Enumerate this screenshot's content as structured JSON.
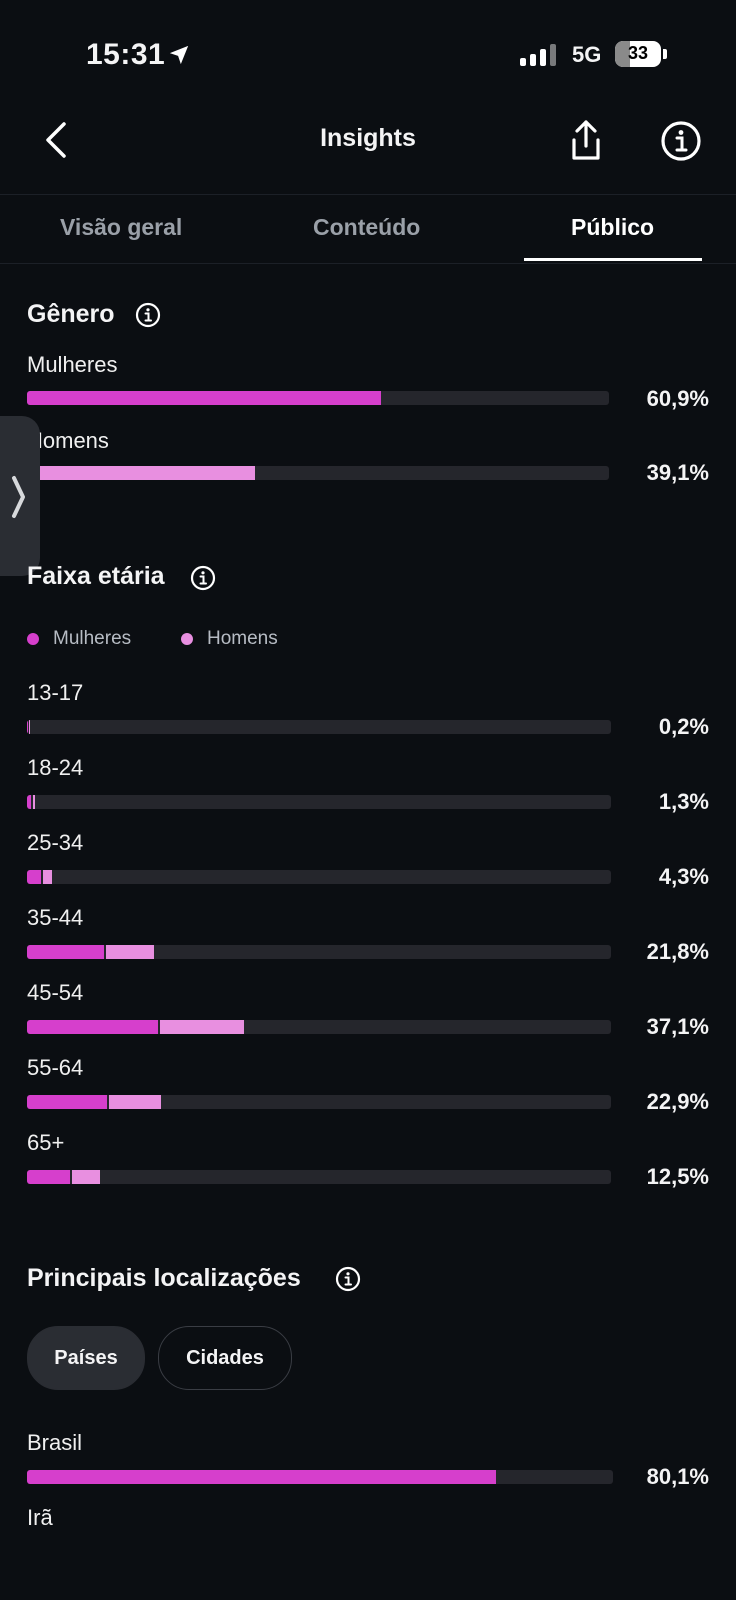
{
  "status": {
    "time": "15:31",
    "network": "5G",
    "battery": "33",
    "battery_level": 0.33
  },
  "header": {
    "title": "Insights",
    "back_icon": "chevron-left-icon",
    "share_icon": "share-icon",
    "info_icon": "info-icon"
  },
  "tabs": [
    {
      "label": "Visão geral",
      "active": false
    },
    {
      "label": "Conteúdo",
      "active": false
    },
    {
      "label": "Público",
      "active": true
    }
  ],
  "colors": {
    "women": "#d63fcc",
    "men": "#e88fe0",
    "track": "#25262c",
    "background": "#0b0e12"
  },
  "gender": {
    "title": "Gênero",
    "rows": [
      {
        "label": "Mulheres",
        "value_text": "60,9%",
        "value": 60.9
      },
      {
        "label": "Homens",
        "value_text": "39,1%",
        "value": 39.1
      }
    ]
  },
  "age": {
    "title": "Faixa etária",
    "legend": {
      "women": "Mulheres",
      "men": "Homens"
    },
    "rows": [
      {
        "label": "13-17",
        "value_text": "0,2%",
        "total": 0.2
      },
      {
        "label": "18-24",
        "value_text": "1,3%",
        "total": 1.3
      },
      {
        "label": "25-34",
        "value_text": "4,3%",
        "total": 4.3
      },
      {
        "label": "35-44",
        "value_text": "21,8%",
        "total": 21.8
      },
      {
        "label": "45-54",
        "value_text": "37,1%",
        "total": 37.1
      },
      {
        "label": "55-64",
        "value_text": "22,9%",
        "total": 22.9
      },
      {
        "label": "65+",
        "value_text": "12,5%",
        "total": 12.5
      }
    ]
  },
  "locations": {
    "title": "Principais localizações",
    "chips": [
      {
        "label": "Países",
        "selected": true
      },
      {
        "label": "Cidades",
        "selected": false
      }
    ],
    "rows": [
      {
        "label": "Brasil",
        "value_text": "80,1%",
        "value": 80.1
      },
      {
        "label": "Irã",
        "value_text": "",
        "value": null
      }
    ]
  }
}
